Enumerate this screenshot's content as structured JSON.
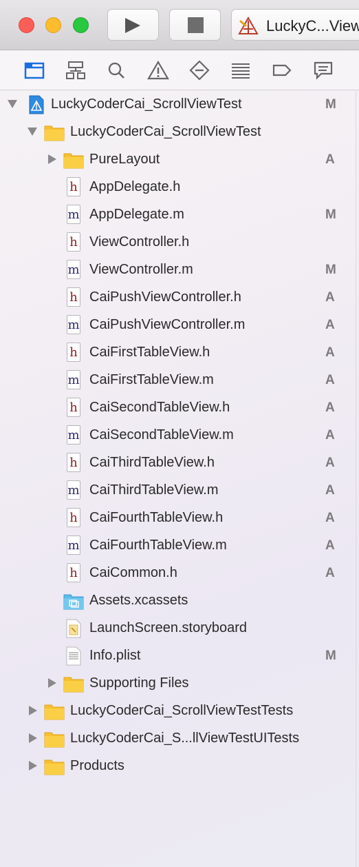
{
  "toolbar": {
    "scheme_label": "LuckyC...View"
  },
  "navigator": {
    "icons": [
      "folder-icon",
      "hierarchy-icon",
      "search-icon",
      "warning-icon",
      "test-diamond-icon",
      "list-icon",
      "tag-icon",
      "comment-icon"
    ],
    "selected": "folder-icon",
    "accent": "#1a6fe0"
  },
  "tree": {
    "project": {
      "label": "LuckyCoderCai_ScrollViewTest",
      "badge": "M"
    },
    "group_main": {
      "label": "LuckyCoderCai_ScrollViewTest"
    },
    "group_purelayout": {
      "label": "PureLayout",
      "badge": "A"
    },
    "files": [
      {
        "label": "AppDelegate.h",
        "type": "h",
        "badge": ""
      },
      {
        "label": "AppDelegate.m",
        "type": "m",
        "badge": "M"
      },
      {
        "label": "ViewController.h",
        "type": "h",
        "badge": ""
      },
      {
        "label": "ViewController.m",
        "type": "m",
        "badge": "M"
      },
      {
        "label": "CaiPushViewController.h",
        "type": "h",
        "badge": "A"
      },
      {
        "label": "CaiPushViewController.m",
        "type": "m",
        "badge": "A"
      },
      {
        "label": "CaiFirstTableView.h",
        "type": "h",
        "badge": "A"
      },
      {
        "label": "CaiFirstTableView.m",
        "type": "m",
        "badge": "A"
      },
      {
        "label": "CaiSecondTableView.h",
        "type": "h",
        "badge": "A"
      },
      {
        "label": "CaiSecondTableView.m",
        "type": "m",
        "badge": "A"
      },
      {
        "label": "CaiThirdTableView.h",
        "type": "h",
        "badge": "A"
      },
      {
        "label": "CaiThirdTableView.m",
        "type": "m",
        "badge": "A"
      },
      {
        "label": "CaiFourthTableView.h",
        "type": "h",
        "badge": "A"
      },
      {
        "label": "CaiFourthTableView.m",
        "type": "m",
        "badge": "A"
      },
      {
        "label": "CaiCommon.h",
        "type": "h",
        "badge": "A"
      }
    ],
    "assets": {
      "label": "Assets.xcassets"
    },
    "launchscreen": {
      "label": "LaunchScreen.storyboard"
    },
    "infoplist": {
      "label": "Info.plist",
      "badge": "M"
    },
    "supporting": {
      "label": "Supporting Files"
    },
    "tests": {
      "label": "LuckyCoderCai_ScrollViewTestTests"
    },
    "uitests": {
      "label": "LuckyCoderCai_S...llViewTestUITests"
    },
    "products": {
      "label": "Products"
    }
  }
}
